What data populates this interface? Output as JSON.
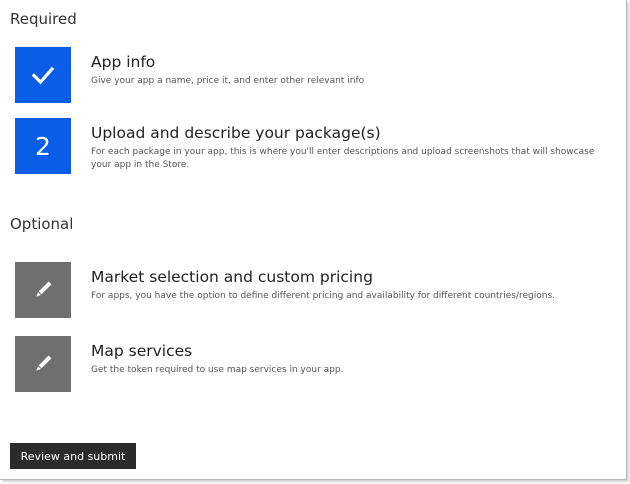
{
  "sections": {
    "required_label": "Required",
    "optional_label": "Optional"
  },
  "steps": [
    {
      "tile": "check-icon",
      "title": "App info",
      "description": "Give your app a name, price it, and enter other relevant info",
      "status": "complete"
    },
    {
      "tile_number": "2",
      "title": "Upload and describe your package(s)",
      "description": "For each package in your app, this is where you'll enter descriptions and upload screenshots that will showcase your app in the Store.",
      "status": "current"
    },
    {
      "tile": "pencil-icon",
      "title": "Market selection and custom pricing",
      "description": "For apps, you have the option to define different pricing and availability for different countries/regions."
    },
    {
      "tile": "pencil-icon",
      "title": "Map services",
      "description": "Get the token required to use map services in your app."
    }
  ],
  "actions": {
    "submit_label": "Review and submit"
  },
  "colors": {
    "required_tile": "#0a5de6",
    "optional_tile": "#6f6f6f",
    "button_bg": "#2b2b2b"
  }
}
